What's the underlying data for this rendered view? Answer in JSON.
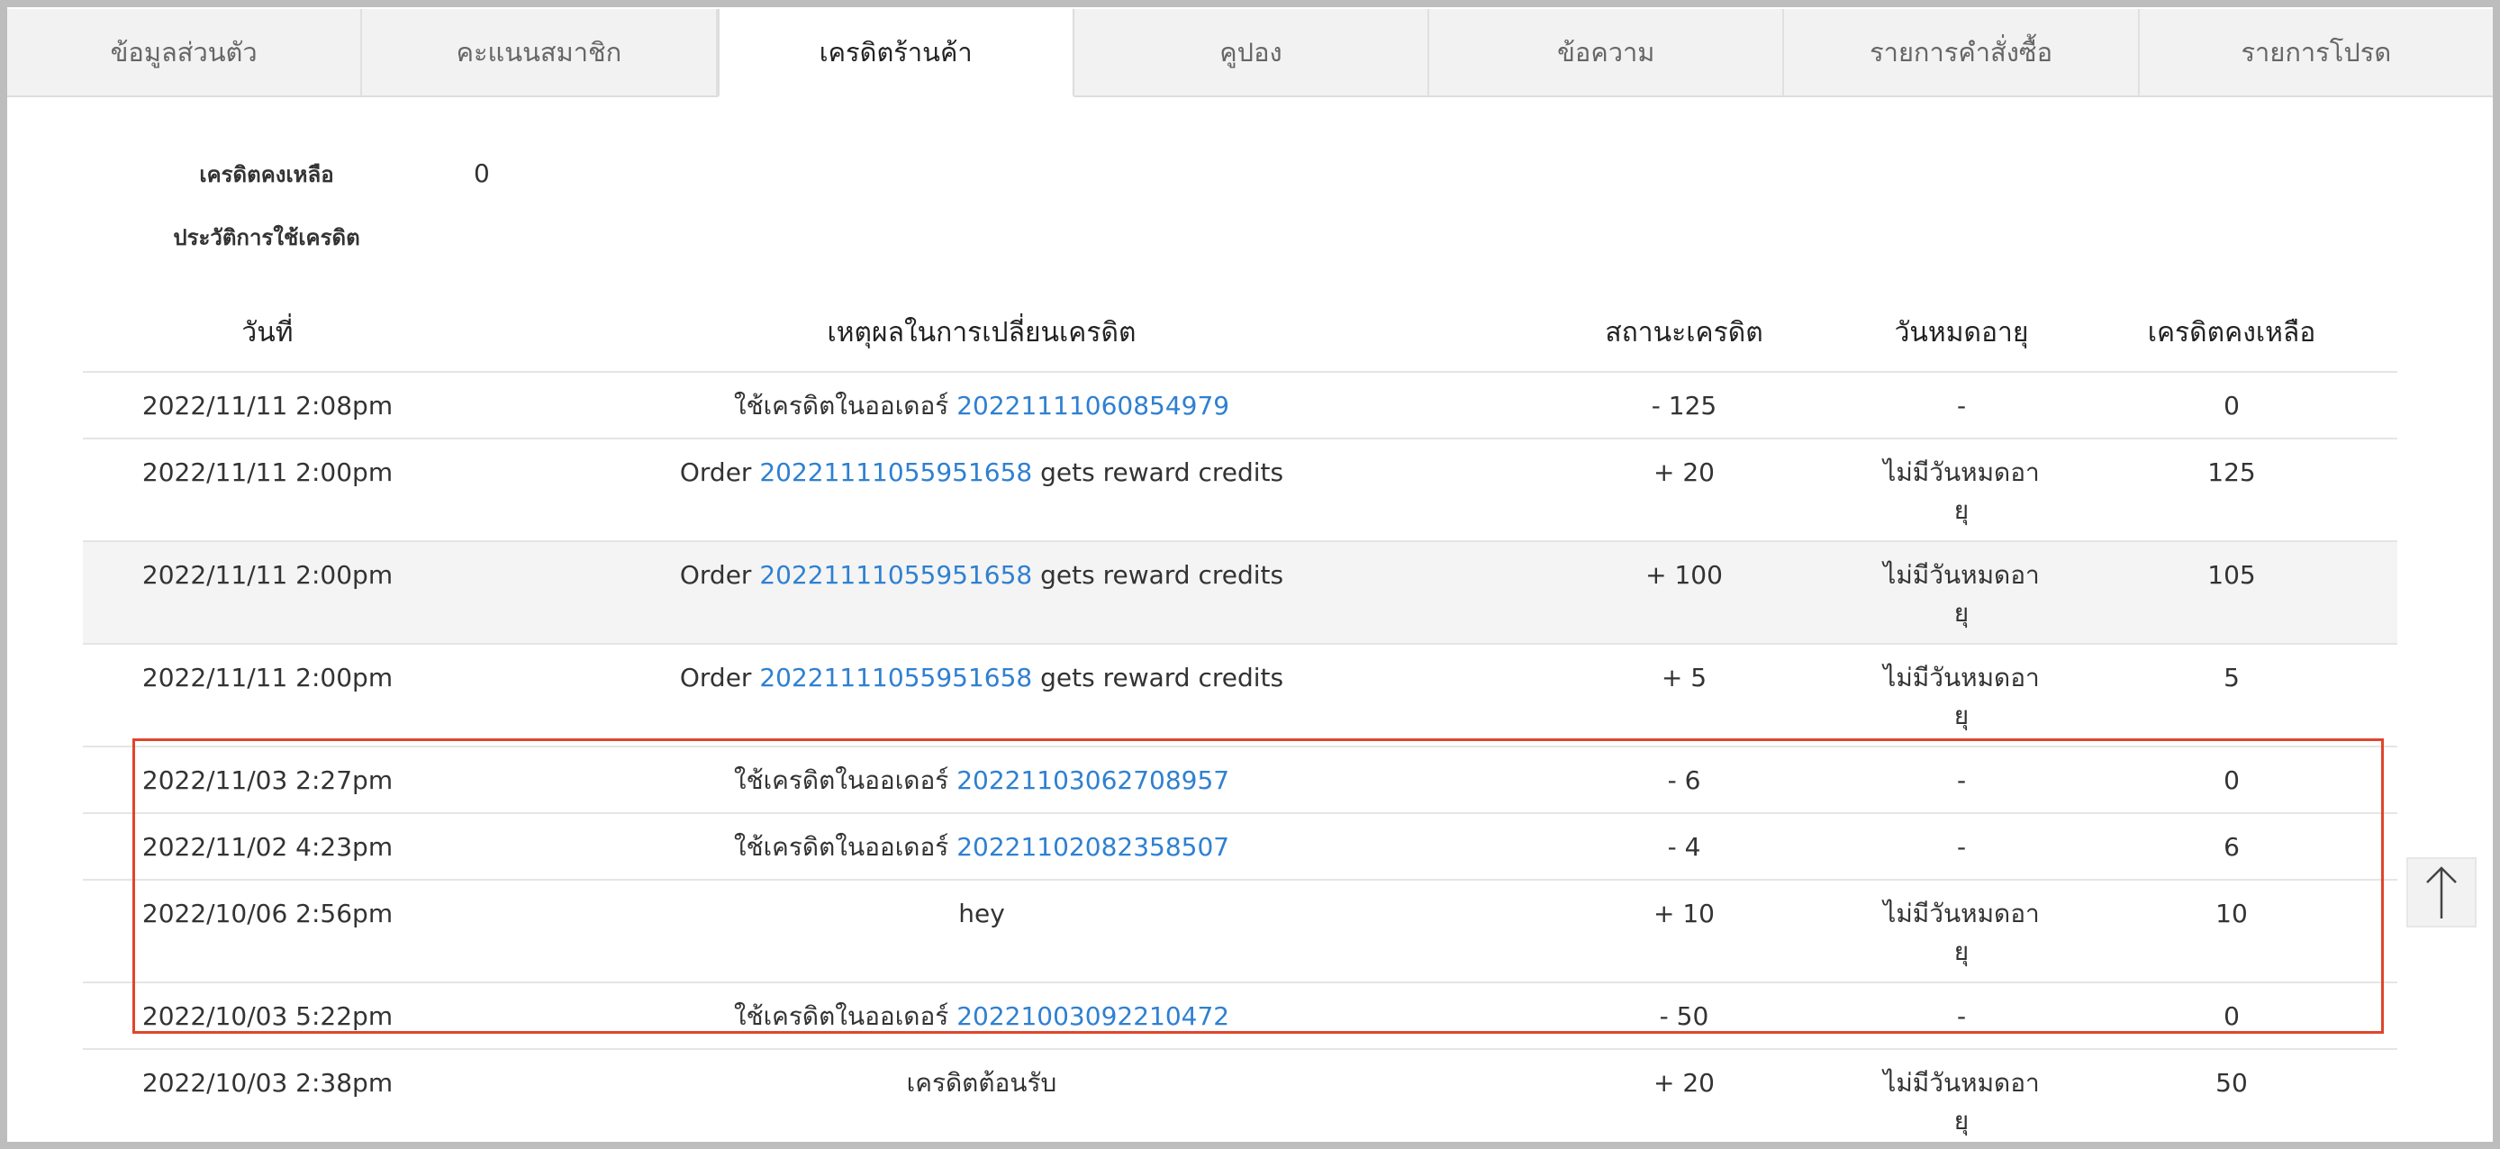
{
  "tabs": [
    {
      "label": "ข้อมูลส่วนตัว",
      "active": false
    },
    {
      "label": "คะแนนสมาชิก",
      "active": false
    },
    {
      "label": "เครดิตร้านค้า",
      "active": true
    },
    {
      "label": "คูปอง",
      "active": false
    },
    {
      "label": "ข้อความ",
      "active": false
    },
    {
      "label": "รายการคำสั่งซื้อ",
      "active": false
    },
    {
      "label": "รายการโปรด",
      "active": false
    }
  ],
  "summary": {
    "balance_label": "เครดิตคงเหลือ",
    "balance_value": "0",
    "history_label": "ประวัติการใช้เครดิต"
  },
  "table": {
    "headers": {
      "date": "วันที่",
      "reason": "เหตุผลในการเปลี่ยนเครดิต",
      "status": "สถานะเครดิต",
      "expiry": "วันหมดอายุ",
      "balance": "เครดิตคงเหลือ"
    },
    "rows": [
      {
        "date": "2022/11/11 2:08pm",
        "reason_prefix": "ใช้เครดิตในออเดอร์ ",
        "order": "20221111060854979",
        "reason_suffix": "",
        "status": "- 125",
        "expiry": "-",
        "balance": "0"
      },
      {
        "date": "2022/11/11 2:00pm",
        "reason_prefix": "Order ",
        "order": "20221111055951658",
        "reason_suffix": " gets reward credits",
        "status": "+ 20",
        "expiry": "ไม่มีวันหมดอายุ",
        "balance": "125"
      },
      {
        "date": "2022/11/11 2:00pm",
        "reason_prefix": "Order ",
        "order": "20221111055951658",
        "reason_suffix": " gets reward credits",
        "status": "+ 100",
        "expiry": "ไม่มีวันหมดอายุ",
        "balance": "105"
      },
      {
        "date": "2022/11/11 2:00pm",
        "reason_prefix": "Order ",
        "order": "20221111055951658",
        "reason_suffix": " gets reward credits",
        "status": "+ 5",
        "expiry": "ไม่มีวันหมดอายุ",
        "balance": "5"
      },
      {
        "date": "2022/11/03 2:27pm",
        "reason_prefix": "ใช้เครดิตในออเดอร์ ",
        "order": "20221103062708957",
        "reason_suffix": "",
        "status": "- 6",
        "expiry": "-",
        "balance": "0"
      },
      {
        "date": "2022/11/02 4:23pm",
        "reason_prefix": "ใช้เครดิตในออเดอร์ ",
        "order": "20221102082358507",
        "reason_suffix": "",
        "status": "- 4",
        "expiry": "-",
        "balance": "6"
      },
      {
        "date": "2022/10/06 2:56pm",
        "reason_prefix": "hey",
        "order": "",
        "reason_suffix": "",
        "status": "+ 10",
        "expiry": "ไม่มีวันหมดอายุ",
        "balance": "10"
      },
      {
        "date": "2022/10/03 5:22pm",
        "reason_prefix": "ใช้เครดิตในออเดอร์ ",
        "order": "20221003092210472",
        "reason_suffix": "",
        "status": "- 50",
        "expiry": "-",
        "balance": "0"
      },
      {
        "date": "2022/10/03 2:38pm",
        "reason_prefix": "เครดิตต้อนรับ",
        "order": "",
        "reason_suffix": "",
        "status": "+ 20",
        "expiry": "ไม่มีวันหมดอายุ",
        "balance": "50"
      }
    ]
  },
  "colors": {
    "link": "#2f80d1",
    "highlight": "#e0452b"
  },
  "icons": {
    "scroll_top": "arrow-up-icon"
  }
}
